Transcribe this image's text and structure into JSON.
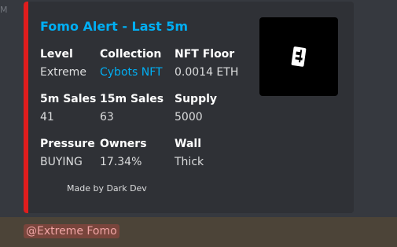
{
  "timestamp_stub": "M",
  "embed": {
    "accent_color": "#e11d1d",
    "title": "Fomo Alert - Last 5m",
    "thumbnail_icon": "nft-collection-icon",
    "fields": [
      {
        "name": "Level",
        "value": "Extreme"
      },
      {
        "name": "Collection",
        "value": "Cybots NFT"
      },
      {
        "name": "NFT Floor",
        "value": "0.0014 ETH"
      },
      {
        "name": "5m Sales",
        "value": "41"
      },
      {
        "name": "15m Sales",
        "value": "63"
      },
      {
        "name": "Supply",
        "value": "5000"
      },
      {
        "name": "Pressure",
        "value": "BUYING"
      },
      {
        "name": "Owners",
        "value": "17.34%"
      },
      {
        "name": "Wall",
        "value": "Thick"
      }
    ],
    "footer": "Made by Dark Dev"
  },
  "mention": "@Extreme Fomo"
}
